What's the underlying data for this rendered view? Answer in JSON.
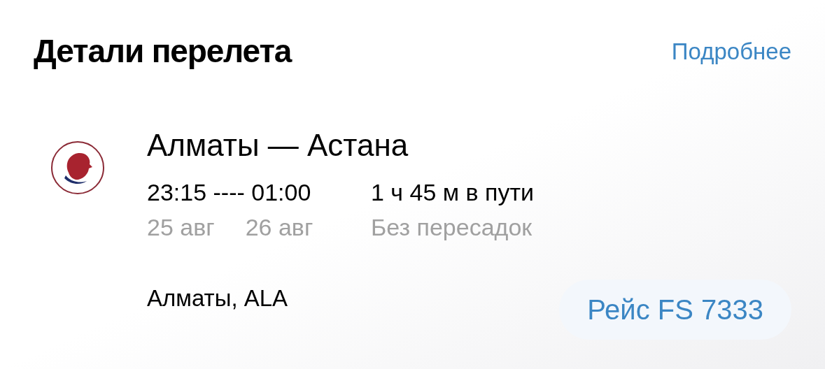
{
  "header": {
    "title": "Детали перелета",
    "link": "Подробнее"
  },
  "flight": {
    "route": "Алматы — Астана",
    "times": "23:15 ---- 01:00",
    "dep_date": "25 авг",
    "arr_date": "26 авг",
    "duration": "1 ч 45 м в пути",
    "stops": "Без пересадок"
  },
  "departure": {
    "city": "Алматы, ALA",
    "flight_number": "Рейс FS 7333"
  }
}
